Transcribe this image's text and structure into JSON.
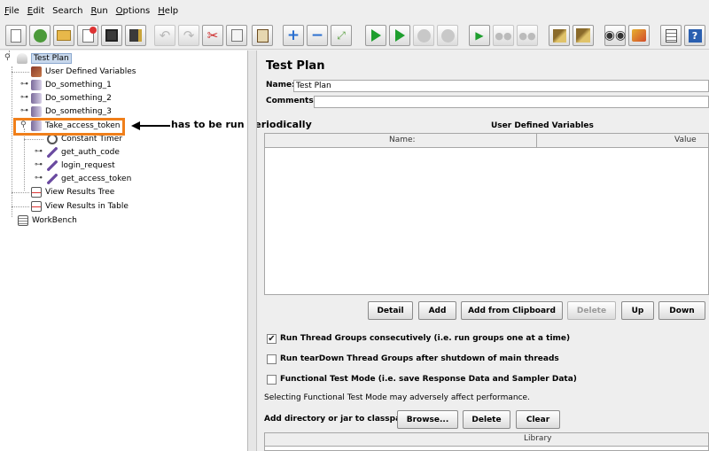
{
  "menu": [
    {
      "pre": "",
      "acc": "F",
      "post": "ile"
    },
    {
      "pre": "",
      "acc": "E",
      "post": "dit"
    },
    {
      "pre": "Search",
      "acc": "",
      "post": ""
    },
    {
      "pre": "",
      "acc": "R",
      "post": "un"
    },
    {
      "pre": "",
      "acc": "O",
      "post": "ptions"
    },
    {
      "pre": "",
      "acc": "H",
      "post": "elp"
    }
  ],
  "toolbar": {
    "buttons": [
      "new-icon",
      "templates-icon",
      "open-icon",
      "close-icon",
      "save-icon",
      "save-as-icon",
      "undo-icon",
      "redo-icon",
      "cut-icon",
      "copy-icon",
      "paste-icon",
      "expand-icon",
      "collapse-icon",
      "toggle-icon",
      "start-icon",
      "start-no-pause-icon",
      "stop-icon",
      "shutdown-icon",
      "remote-start-icon",
      "remote-stop-icon",
      "remote-shutdown-icon",
      "clear-icon",
      "clear-all-icon",
      "search-icon",
      "reset-search-icon",
      "function-helper-icon",
      "help-icon"
    ]
  },
  "tree": {
    "root": "Test Plan",
    "items": [
      {
        "label": "User Defined Variables"
      },
      {
        "label": "Do_something_1"
      },
      {
        "label": "Do_something_2"
      },
      {
        "label": "Do_something_3"
      },
      {
        "label": "Take_access_token"
      },
      {
        "label": "Constant Timer"
      },
      {
        "label": "get_auth_code"
      },
      {
        "label": "login_request"
      },
      {
        "label": "get_access_token"
      },
      {
        "label": "View Results Tree"
      },
      {
        "label": "View Results in Table"
      },
      {
        "label": "WorkBench"
      }
    ]
  },
  "annotation": {
    "text": "has to be run periodically",
    "highlight_color": "#f07f1a"
  },
  "panel": {
    "title": "Test Plan",
    "name_label": "Name:",
    "name_value": "Test Plan",
    "comments_label": "Comments:",
    "udv_title": "User Defined Variables",
    "col_name": "Name:",
    "col_value": "Value",
    "buttons": {
      "detail": "Detail",
      "add": "Add",
      "add_clipboard": "Add from Clipboard",
      "delete": "Delete",
      "up": "Up",
      "down": "Down"
    },
    "options": [
      {
        "label": "Run Thread Groups consecutively (i.e. run groups one at a time)",
        "checked": true
      },
      {
        "label": "Run tearDown Thread Groups after shutdown of main threads",
        "checked": false
      },
      {
        "label": "Functional Test Mode (i.e. save Response Data and Sampler Data)",
        "checked": false
      }
    ],
    "functional_note": "Selecting Functional Test Mode may adversely affect performance.",
    "classpath_label": "Add directory or jar to classpath",
    "browse": "Browse...",
    "cp_delete": "Delete",
    "clear": "Clear",
    "library_header": "Library"
  },
  "colors": {
    "selection": "#c8d8ec",
    "highlight": "#f07f1a"
  }
}
